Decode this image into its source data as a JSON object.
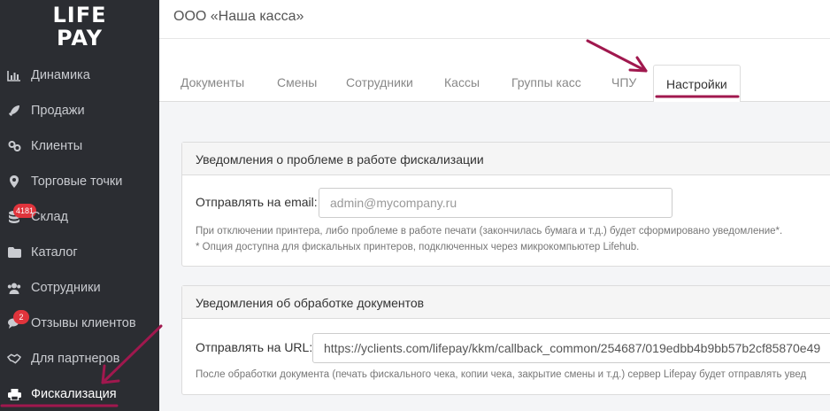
{
  "brand": {
    "logo_line1": "LIFE",
    "logo_line2": "PAY"
  },
  "sidebar": {
    "items": [
      {
        "label": "Динамика",
        "icon": "bar-chart-icon"
      },
      {
        "label": "Продажи",
        "icon": "rocket-icon"
      },
      {
        "label": "Клиенты",
        "icon": "link-icon"
      },
      {
        "label": "Торговые точки",
        "icon": "map-marker-icon"
      },
      {
        "label": "Склад",
        "icon": "database-icon",
        "badge": "4181"
      },
      {
        "label": "Каталог",
        "icon": "folder-icon"
      },
      {
        "label": "Сотрудники",
        "icon": "users-icon"
      },
      {
        "label": "Отзывы клиентов",
        "icon": "comments-icon",
        "badge": "2"
      },
      {
        "label": "Для партнеров",
        "icon": "handshake-icon"
      },
      {
        "label": "Фискализация",
        "icon": "printer-icon",
        "active": true
      }
    ]
  },
  "header": {
    "title": "ООО «Наша касса»"
  },
  "tabs": [
    {
      "label": "Документы"
    },
    {
      "label": "Смены"
    },
    {
      "label": "Сотрудники"
    },
    {
      "label": "Кассы"
    },
    {
      "label": "Группы касс"
    },
    {
      "label": "ЧПУ"
    },
    {
      "label": "Настройки",
      "active": true
    }
  ],
  "panels": {
    "fiscal_problem": {
      "title": "Уведомления о проблеме в работе фискализации",
      "email_label": "Отправлять на email:",
      "email_placeholder": "admin@mycompany.ru",
      "help_line1": "При отключении принтера, либо проблеме в работе печати (закончилась бумага и т.д.) будет сформировано уведомление*.",
      "help_line2": "* Опция доступна для фискальных принтеров, подключенных через микрокомпьютер Lifehub."
    },
    "doc_processing": {
      "title": "Уведомления об обработке документов",
      "url_label": "Отправлять на URL:",
      "url_value": "https://yclients.com/lifepay/kkm/callback_common/254687/019edbb4b9bb57b2cf85870e49",
      "help_line1": "После обработки документа (печать фискального чека, копии чека, закрытие смены и т.д.) сервер Lifepay будет отправлять увед"
    }
  },
  "colors": {
    "sidebar_bg": "#2b2d32",
    "annotation": "#a0184e",
    "badge": "#e0343c"
  }
}
